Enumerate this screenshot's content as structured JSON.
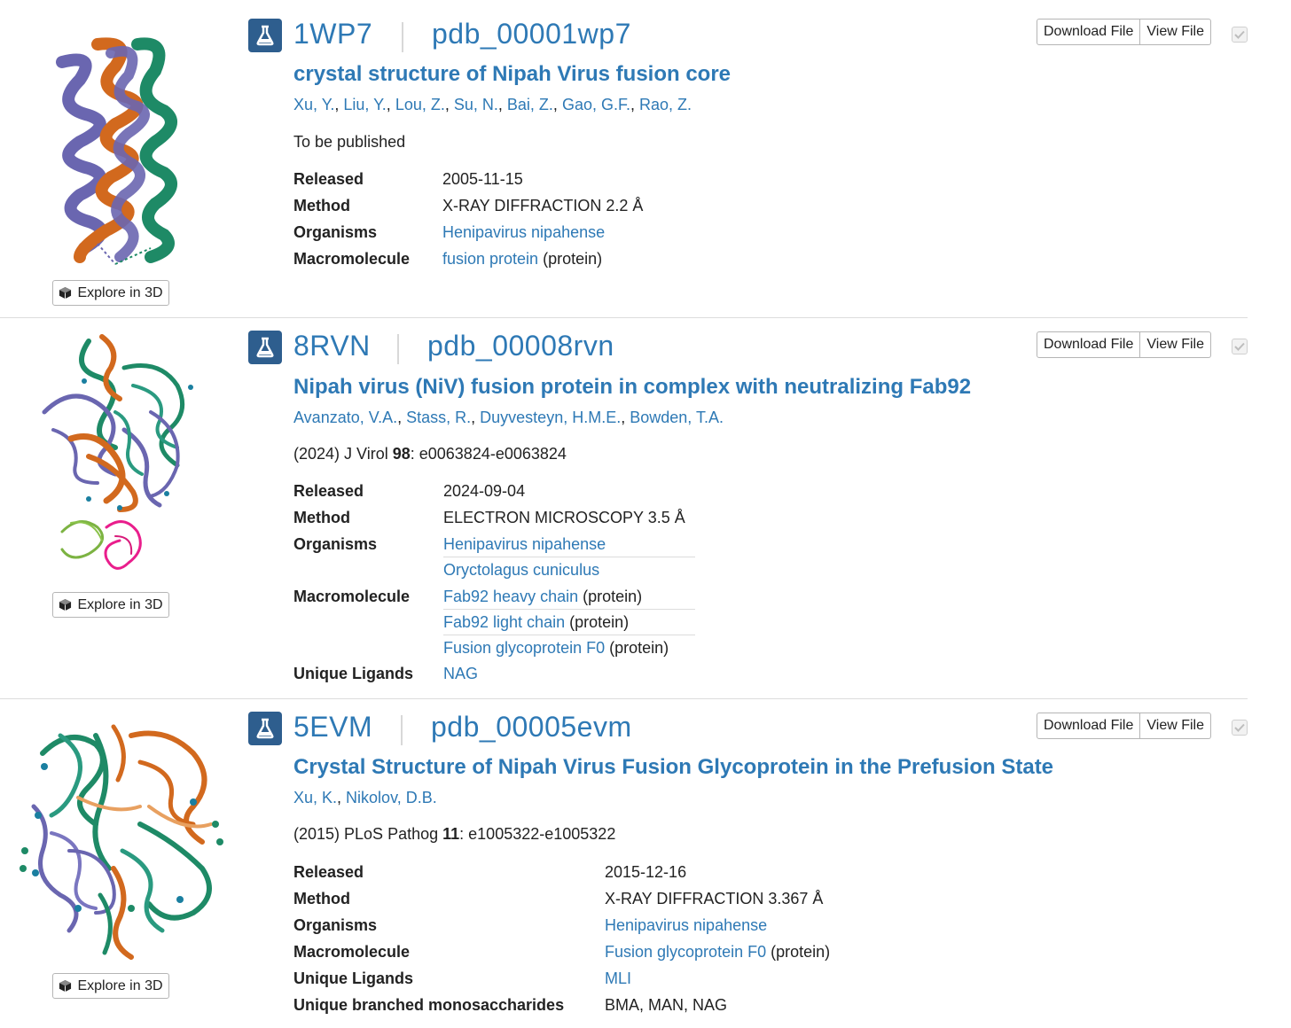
{
  "common": {
    "explore_label": "Explore in 3D",
    "download_label": "Download File",
    "view_label": "View File"
  },
  "entries": [
    {
      "id": "1WP7",
      "ext_id": "pdb_00001wp7",
      "title": "crystal structure of Nipah Virus fusion core",
      "authors": [
        "Xu, Y.",
        "Liu, Y.",
        "Lou, Z.",
        "Su, N.",
        "Bai, Z.",
        "Gao, G.F.",
        "Rao, Z."
      ],
      "citation": "To be published",
      "released_label": "Released",
      "released": "2005-11-15",
      "method_label": "Method",
      "method": "X-RAY DIFFRACTION 2.2 Å",
      "organisms_label": "Organisms",
      "organisms": [
        "Henipavirus nipahense"
      ],
      "macromolecule_label": "Macromolecule",
      "macromolecules": [
        {
          "name": "fusion protein",
          "type": "(protein)"
        }
      ]
    },
    {
      "id": "8RVN",
      "ext_id": "pdb_00008rvn",
      "title": "Nipah virus (NiV) fusion protein in complex with neutralizing Fab92",
      "authors": [
        "Avanzato, V.A.",
        "Stass, R.",
        "Duyvesteyn, H.M.E.",
        "Bowden, T.A."
      ],
      "citation_prefix": "(2024) J Virol ",
      "citation_volume": "98",
      "citation_pages": ": e0063824-e0063824",
      "released_label": "Released",
      "released": "2024-09-04",
      "method_label": "Method",
      "method": "ELECTRON MICROSCOPY 3.5 Å",
      "organisms_label": "Organisms",
      "organisms": [
        "Henipavirus nipahense",
        "Oryctolagus cuniculus"
      ],
      "macromolecule_label": "Macromolecule",
      "macromolecules": [
        {
          "name": "Fab92 heavy chain",
          "type": "(protein)"
        },
        {
          "name": "Fab92 light chain",
          "type": "(protein)"
        },
        {
          "name": "Fusion glycoprotein F0",
          "type": "(protein)"
        }
      ],
      "ligands_label": "Unique Ligands",
      "ligands": "NAG"
    },
    {
      "id": "5EVM",
      "ext_id": "pdb_00005evm",
      "title": "Crystal Structure of Nipah Virus Fusion Glycoprotein in the Prefusion State",
      "authors": [
        "Xu, K.",
        "Nikolov, D.B."
      ],
      "citation_prefix": "(2015) PLoS Pathog ",
      "citation_volume": "11",
      "citation_pages": ": e1005322-e1005322",
      "released_label": "Released",
      "released": "2015-12-16",
      "method_label": "Method",
      "method": "X-RAY DIFFRACTION 3.367 Å",
      "organisms_label": "Organisms",
      "organisms": [
        "Henipavirus nipahense"
      ],
      "macromolecule_label": "Macromolecule",
      "macromolecules": [
        {
          "name": "Fusion glycoprotein F0",
          "type": "(protein)"
        }
      ],
      "ligands_label": "Unique Ligands",
      "ligands": "MLI",
      "branched_label": "Unique branched monosaccharides",
      "branched": "BMA, MAN, NAG"
    }
  ]
}
